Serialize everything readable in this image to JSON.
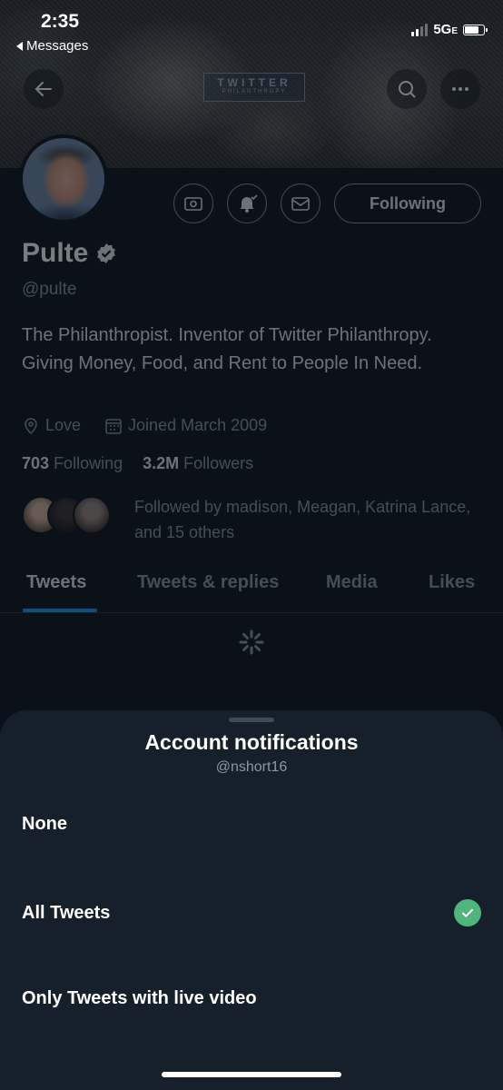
{
  "status_bar": {
    "time": "2:35",
    "back_label": "Messages",
    "network": "5G",
    "network_suffix": "E"
  },
  "banner": {
    "logo_line1": "TWITTER",
    "logo_line2": "PHILANTHROPY"
  },
  "profile": {
    "name": "Pulte",
    "handle": "@pulte",
    "following_button": "Following",
    "bio": "The Philanthropist. Inventor of Twitter Philanthropy. Giving Money, Food, and Rent to People In Need.",
    "location": "Love",
    "joined": "Joined March 2009",
    "following_count": "703",
    "following_label": "Following",
    "followers_count": "3.2M",
    "followers_label": "Followers",
    "followed_by": "Followed by madison, Meagan, Katrina Lance, and 15 others"
  },
  "tabs": [
    "Tweets",
    "Tweets & replies",
    "Media",
    "Likes"
  ],
  "sheet": {
    "title": "Account notifications",
    "subtitle": "@nshort16",
    "options": [
      "None",
      "All Tweets",
      "Only Tweets with live video"
    ],
    "selected_option": "All Tweets"
  },
  "colors": {
    "accent": "#1d9bf0",
    "check": "#4fb57d",
    "sheet_bg": "#16202a"
  }
}
